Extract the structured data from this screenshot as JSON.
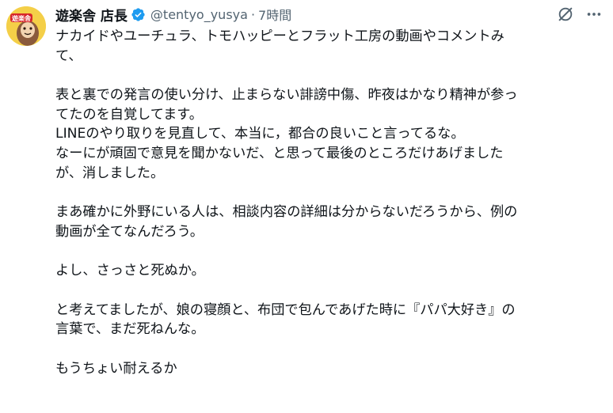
{
  "author": {
    "name": "遊楽舎 店長",
    "handle": "@tentyo_yusya",
    "separator": "·",
    "time": "7時間",
    "avatar_text": "遊楽舎"
  },
  "actions": {
    "grok_icon": "slash-circle-icon",
    "more_icon": "more-dots-icon",
    "more_label": "···"
  },
  "tweet": {
    "lines": [
      "ナカイドやユーチュラ、トモハッピーとフラット工房の動画やコメントみ",
      "て、",
      "",
      "表と裏での発言の使い分け、止まらない誹謗中傷、昨夜はかなり精神が参っ",
      "てたのを自覚してます。",
      "LINEのやり取りを見直して、本当に，都合の良いこと言ってるな。",
      "なーにが頑固で意見を聞かないだ、と思って最後のところだけあげました",
      "が、消しました。",
      "",
      "まあ確かに外野にいる人は、相談内容の詳細は分からないだろうから、例の",
      "動画が全てなんだろう。",
      "",
      "よし、さっさと死ぬか。",
      "",
      "と考えてましたが、娘の寝顔と、布団で包んであげた時に『パパ大好き』の",
      "言葉で、まだ死ねんな。",
      "",
      "もうちょい耐えるか"
    ]
  },
  "colors": {
    "text": "#0f1419",
    "secondary": "#536471",
    "verified": "#1d9bf0",
    "avatar_bg": "#f6d24a"
  }
}
